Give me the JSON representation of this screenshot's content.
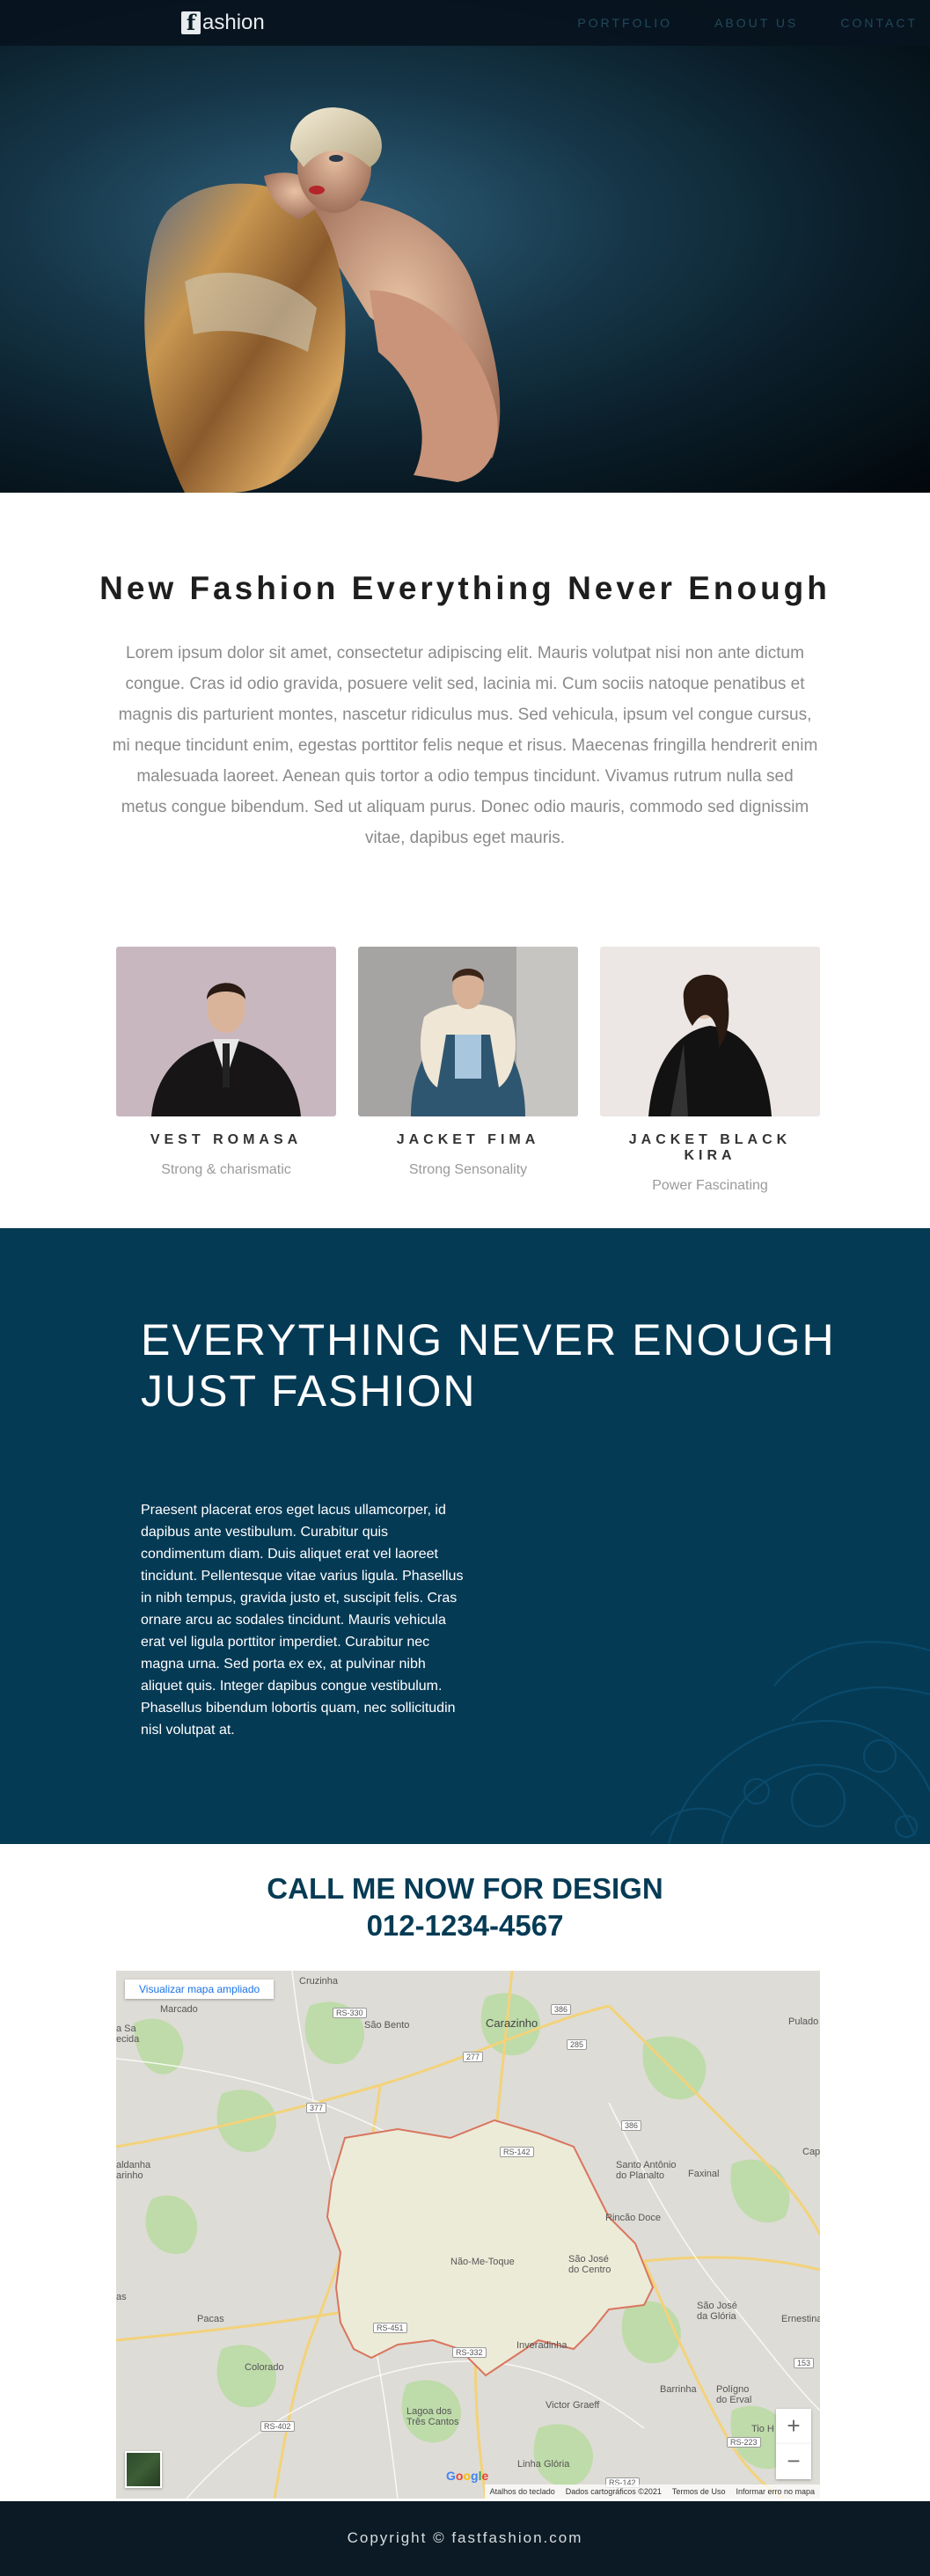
{
  "nav": {
    "logo_letter": "f",
    "logo_rest": "ashion",
    "links": [
      "PORTFOLIO",
      "ABOUT US",
      "CONTACT"
    ]
  },
  "intro": {
    "title": "New Fashion Everything Never Enough",
    "text": "Lorem ipsum dolor sit amet, consectetur adipiscing elit. Mauris volutpat nisi non ante dictum congue. Cras id odio gravida, posuere velit sed, lacinia mi. Cum sociis natoque penatibus et magnis dis parturient montes, nascetur ridiculus mus. Sed vehicula, ipsum vel congue cursus, mi neque tincidunt enim, egestas porttitor felis neque et risus. Maecenas fringilla hendrerit enim malesuada laoreet. Aenean quis tortor a odio tempus tincidunt. Vivamus rutrum nulla sed metus congue bibendum. Sed ut aliquam purus. Donec odio mauris, commodo sed dignissim vitae, dapibus eget mauris."
  },
  "products": [
    {
      "name": "VEST ROMASA",
      "tagline": "Strong & charismatic"
    },
    {
      "name": "JACKET FIMA",
      "tagline": "Strong Sensonality"
    },
    {
      "name": "JACKET BLACK KIRA",
      "tagline": "Power Fascinating"
    }
  ],
  "feature": {
    "title_line1": "EVERYTHING NEVER ENOUGH",
    "title_line2": "JUST FASHION",
    "text": "Praesent placerat eros eget lacus ullamcorper, id dapibus ante vestibulum. Curabitur quis condimentum diam. Duis aliquet erat vel laoreet tincidunt. Pellentesque vitae varius ligula. Phasellus in nibh tempus, gravida justo et, suscipit felis. Cras ornare arcu ac sodales tincidunt. Mauris vehicula erat vel ligula porttitor imperdiet. Curabitur nec magna urna. Sed porta ex ex, at pulvinar nibh aliquet quis. Integer dapibus congue vestibulum. Phasellus bibendum lobortis quam, nec sollicitudin nisl volutpat at."
  },
  "call": {
    "line1": "CALL ME NOW FOR DESIGN",
    "phone": "012-1234-4567"
  },
  "map": {
    "view_larger": "Visualizar mapa ampliado",
    "places": {
      "cruzinha": "Cruzinha",
      "marcado": "Marcado",
      "sao_bento": "São Bento",
      "carazinho": "Carazinho",
      "pulado": "Pulado",
      "sa_ecida": "a Sa\necida",
      "aldanha": "aldanha\narinho",
      "santo_antonio": "Santo Antônio\ndo Planalto",
      "faxinal": "Faxinal",
      "cap": "Cap",
      "rincao_doce": "Rincão Doce",
      "nao_me_toque": "Não-Me-Toque",
      "sao_jose_centro": "São José\ndo Centro",
      "pacas": "Pacas",
      "as": "as",
      "sao_jose_gloria": "São José\nda Glória",
      "ernestina": "Ernestina",
      "colorado": "Colorado",
      "inveradinha": "Inveradinha",
      "barrinha": "Barrinha",
      "poligno": "Polígno\ndo Erval",
      "lagoa": "Lagoa dos\nTrês Cantos",
      "victor_graeff": "Victor Graeff",
      "tio": "Tio H",
      "linha_gloria": "Linha Glória"
    },
    "roads": [
      "RS-330",
      "386",
      "285",
      "277",
      "377",
      "386",
      "RS-142",
      "RS-451",
      "RS-332",
      "RS-402",
      "RS-223",
      "RS-142",
      "153"
    ],
    "google": "Google",
    "attribution": [
      "Atalhos do teclado",
      "Dados cartográficos ©2021",
      "Termos de Uso",
      "Informar erro no mapa"
    ],
    "zoom_in": "+",
    "zoom_out": "−"
  },
  "footer": {
    "copyright": "Copyright © fastfashion.com"
  }
}
